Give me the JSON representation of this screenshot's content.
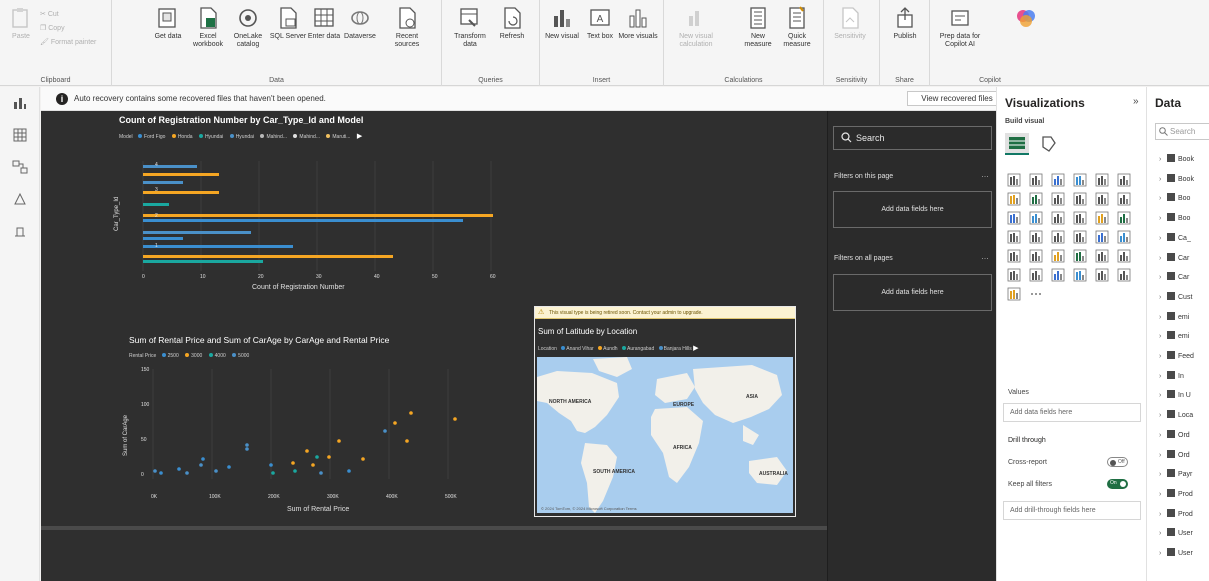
{
  "ribbon": {
    "groups": [
      {
        "name": "Clipboard",
        "buttons": [
          "Paste",
          "Cut",
          "Copy",
          "Format painter"
        ]
      },
      {
        "name": "Data",
        "buttons": [
          "Get data",
          "Excel workbook",
          "OneLake catalog",
          "SQL Server",
          "Enter data",
          "Dataverse",
          "Recent sources"
        ]
      },
      {
        "name": "Queries",
        "buttons": [
          "Transform data",
          "Refresh"
        ]
      },
      {
        "name": "Insert",
        "buttons": [
          "New visual",
          "Text box",
          "More visuals"
        ]
      },
      {
        "name": "Calculations",
        "buttons": [
          "New visual calculation",
          "New measure",
          "Quick measure"
        ]
      },
      {
        "name": "Sensitivity",
        "buttons": [
          "Sensitivity"
        ]
      },
      {
        "name": "Share",
        "buttons": [
          "Publish"
        ]
      },
      {
        "name": "Copilot",
        "buttons": [
          "Prep data for Copilot AI",
          ""
        ]
      }
    ]
  },
  "infobar": {
    "message": "Auto recovery contains some recovered files that haven't been opened.",
    "view_button": "View recovered files"
  },
  "bar_chart": {
    "title": "Count of Registration Number by Car_Type_Id and Model",
    "legend_label": "Model",
    "legend_items": [
      "Ford Figo",
      "Honda",
      "Hyundai",
      "Hyundai",
      "Mahind...",
      "Mahind...",
      "Maruti..."
    ],
    "ylabel": "Car_Type_Id",
    "xlabel": "Count of Registration Number",
    "x_ticks": [
      "0",
      "10",
      "20",
      "30",
      "40",
      "50",
      "60"
    ],
    "y_ticks": [
      "4",
      "3",
      "2",
      "1"
    ]
  },
  "scatter_chart": {
    "title": "Sum of Rental Price and Sum of CarAge by CarAge and Rental Price",
    "legend_label": "Rental Price",
    "legend_items": [
      "2500",
      "3000",
      "4000",
      "5000"
    ],
    "ylabel": "Sum of CarAge",
    "xlabel": "Sum of Rental Price",
    "y_ticks": [
      "150",
      "100",
      "50",
      "0"
    ],
    "x_ticks": [
      "0K",
      "100K",
      "200K",
      "300K",
      "400K",
      "500K"
    ]
  },
  "map_visual": {
    "warning": "This visual type is being retired soon. Contact your admin to upgrade.",
    "title": "Sum of Latitude by Location",
    "legend_label": "Location",
    "legend_items": [
      "Anand Vihar",
      "Aundh",
      "Aurangabad",
      "Banjara Hills"
    ],
    "continents": [
      "NORTH AMERICA",
      "EUROPE",
      "ASIA",
      "AFRICA",
      "SOUTH AMERICA",
      "AUSTRALIA"
    ],
    "footer": "© 2024 TomTom, © 2024 Microsoft Corporation  Terms"
  },
  "filters": {
    "search": "Search",
    "on_page": "Filters on this page",
    "on_all_pages": "Filters on all pages",
    "add_fields": "Add data fields here",
    "add_fields_2": "Add data fields here"
  },
  "visualizations": {
    "title": "Visualizations",
    "build_visual": "Build visual",
    "values_label": "Values",
    "values_placeholder": "Add data fields here",
    "drill_through": "Drill through",
    "cross_report": "Cross-report",
    "cross_report_state": "Off",
    "keep_all_filters": "Keep all filters",
    "keep_all_filters_state": "On",
    "drill_placeholder": "Add drill-through fields here"
  },
  "data_pane": {
    "title": "Data",
    "search_placeholder": "Search",
    "tables": [
      "Book",
      "Book",
      "Boo",
      "Boo",
      "Ca_",
      "Car",
      "Car",
      "Cust",
      "emi",
      "emi",
      "Feed",
      "In",
      "In U",
      "Loca",
      "Ord",
      "Ord",
      "Payr",
      "Prod",
      "Prod",
      "User",
      "User"
    ]
  },
  "colors": {
    "canvas": "#2f2f2f",
    "accent_orange": "#f5a623",
    "accent_blue": "#4a90c8",
    "accent_teal": "#1aa8a0",
    "toggle_on": "#1f6e43"
  }
}
